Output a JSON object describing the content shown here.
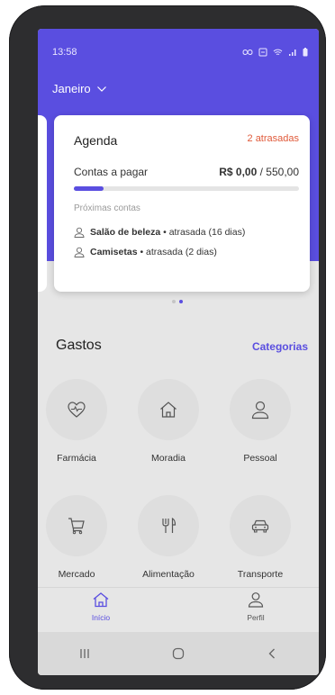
{
  "status_bar": {
    "time": "13:58"
  },
  "header": {
    "month": "Janeiro"
  },
  "agenda": {
    "title": "Agenda",
    "late_badge": "2 atrasadas",
    "bills_label": "Contas a pagar",
    "paid": "R$ 0,00",
    "total": "/ 550,00",
    "progress_fraction": 0.0,
    "next_label": "Próximas contas",
    "items": [
      {
        "name": "Salão de beleza",
        "status": "• atrasada (16 dias)"
      },
      {
        "name": "Camisetas",
        "status": "• atrasada (2 dias)"
      }
    ]
  },
  "expenses": {
    "title": "Gastos",
    "link": "Categorias",
    "categories": [
      {
        "label": "Farmácia",
        "icon": "heart-pulse-icon"
      },
      {
        "label": "Moradia",
        "icon": "house-icon"
      },
      {
        "label": "Pessoal",
        "icon": "person-icon"
      },
      {
        "label": "Mercado",
        "icon": "cart-icon"
      },
      {
        "label": "Alimentação",
        "icon": "cutlery-icon"
      },
      {
        "label": "Transporte",
        "icon": "car-icon"
      }
    ]
  },
  "bottom_nav": {
    "home": "Início",
    "profile": "Perfil"
  },
  "colors": {
    "accent": "#5a4ee0",
    "late": "#e05a3a"
  }
}
